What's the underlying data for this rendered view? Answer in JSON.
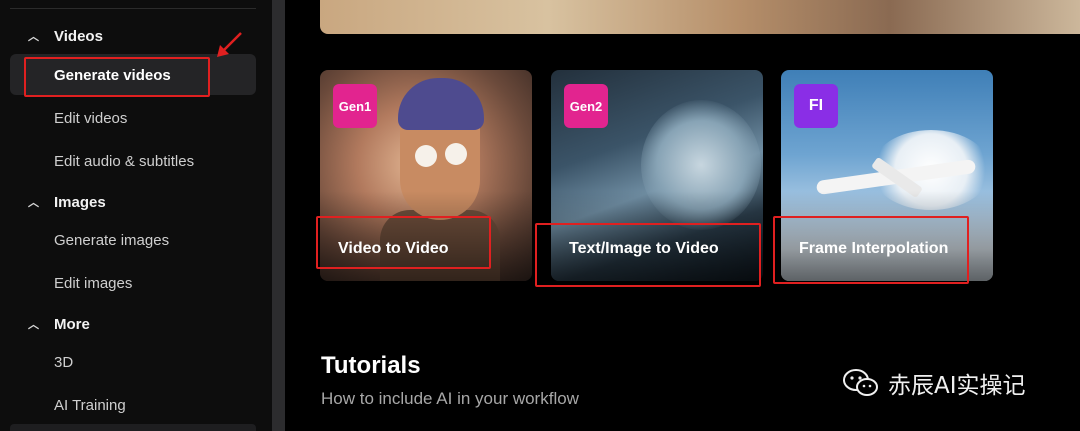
{
  "sidebar": {
    "sections": [
      {
        "label": "Videos",
        "expanded": true,
        "items": [
          "Generate videos",
          "Edit videos",
          "Edit audio & subtitles"
        ]
      },
      {
        "label": "Images",
        "expanded": true,
        "items": [
          "Generate images",
          "Edit images"
        ]
      },
      {
        "label": "More",
        "expanded": true,
        "items": [
          "3D",
          "AI Training"
        ]
      }
    ],
    "active_item": "Generate videos",
    "chevron_icon": "chevron-up-icon"
  },
  "cards": [
    {
      "badge": "Gen1",
      "badge_color": "#e2248f",
      "title": "Video to Video"
    },
    {
      "badge": "Gen2",
      "badge_color": "#e2248f",
      "title": "Text/Image to Video"
    },
    {
      "badge": "FI",
      "badge_color": "#8a2ee6",
      "title": "Frame Interpolation"
    }
  ],
  "tutorials": {
    "title": "Tutorials",
    "subtitle": "How to include AI in your workflow"
  },
  "watermark": {
    "icon": "wechat-icon",
    "text": "赤辰AI实操记"
  },
  "colors": {
    "annotation_red": "#e02020",
    "sidebar_bg": "#0d0d0d",
    "active_item_bg": "#242426"
  }
}
